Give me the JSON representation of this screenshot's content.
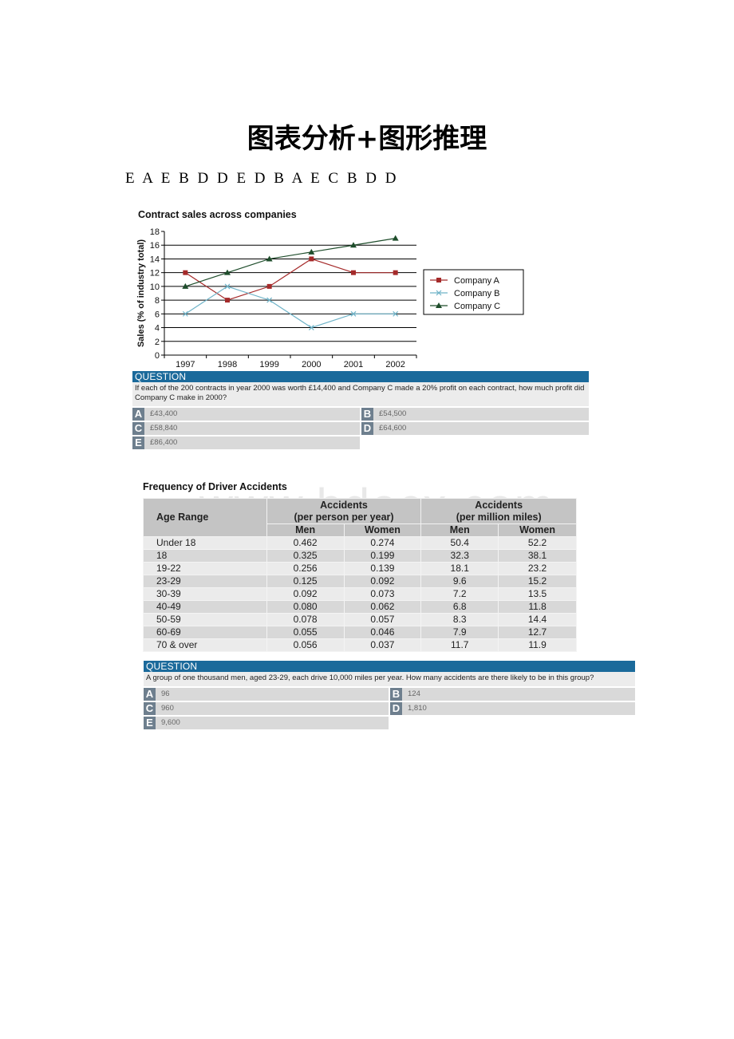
{
  "document": {
    "title": "图表分析+图形推理",
    "answer_key": "E A E B D D E D B A E C B D D",
    "watermark": "www.bdocx.com"
  },
  "chart_data": {
    "type": "line",
    "title": "Contract sales across companies",
    "xlabel": "",
    "ylabel": "Sales (% of industry total)",
    "x": [
      "1997",
      "1998",
      "1999",
      "2000",
      "2001",
      "2002"
    ],
    "ylim": [
      0,
      18
    ],
    "yticks": [
      0,
      2,
      4,
      6,
      8,
      10,
      12,
      14,
      16,
      18
    ],
    "grid": true,
    "legend_position": "right",
    "series": [
      {
        "name": "Company A",
        "values": [
          12,
          8,
          10,
          14,
          12,
          12
        ],
        "color": "#a52a2a",
        "marker": "square"
      },
      {
        "name": "Company B",
        "values": [
          6,
          10,
          8,
          4,
          6,
          6
        ],
        "color": "#6fb3c8",
        "marker": "x"
      },
      {
        "name": "Company C",
        "values": [
          10,
          12,
          14,
          15,
          16,
          17
        ],
        "color": "#1e4d2b",
        "marker": "triangle"
      }
    ]
  },
  "question1": {
    "header": "QUESTION",
    "text": "If each of the 200 contracts in year 2000 was worth £14,400 and Company C made a 20% profit on each contract, how much profit did Company C make in 2000?",
    "options": [
      {
        "letter": "A",
        "text": "£43,400"
      },
      {
        "letter": "B",
        "text": "£54,500"
      },
      {
        "letter": "C",
        "text": "£58,840"
      },
      {
        "letter": "D",
        "text": "£64,600"
      },
      {
        "letter": "E",
        "text": "£86,400"
      }
    ]
  },
  "table": {
    "title": "Frequency of Driver Accidents",
    "header": {
      "age_range": "Age Range",
      "group1": "Accidents",
      "group1_sub": "(per person per year)",
      "group2": "Accidents",
      "group2_sub": "(per million miles)",
      "men": "Men",
      "women": "Women"
    },
    "rows": [
      {
        "age": "Under 18",
        "pp_men": "0.462",
        "pp_women": "0.274",
        "pm_men": "50.4",
        "pm_women": "52.2"
      },
      {
        "age": "18",
        "pp_men": "0.325",
        "pp_women": "0.199",
        "pm_men": "32.3",
        "pm_women": "38.1"
      },
      {
        "age": "19-22",
        "pp_men": "0.256",
        "pp_women": "0.139",
        "pm_men": "18.1",
        "pm_women": "23.2"
      },
      {
        "age": "23-29",
        "pp_men": "0.125",
        "pp_women": "0.092",
        "pm_men": "9.6",
        "pm_women": "15.2"
      },
      {
        "age": "30-39",
        "pp_men": "0.092",
        "pp_women": "0.073",
        "pm_men": "7.2",
        "pm_women": "13.5"
      },
      {
        "age": "40-49",
        "pp_men": "0.080",
        "pp_women": "0.062",
        "pm_men": "6.8",
        "pm_women": "11.8"
      },
      {
        "age": "50-59",
        "pp_men": "0.078",
        "pp_women": "0.057",
        "pm_men": "8.3",
        "pm_women": "14.4"
      },
      {
        "age": "60-69",
        "pp_men": "0.055",
        "pp_women": "0.046",
        "pm_men": "7.9",
        "pm_women": "12.7"
      },
      {
        "age": "70 & over",
        "pp_men": "0.056",
        "pp_women": "0.037",
        "pm_men": "11.7",
        "pm_women": "11.9"
      }
    ]
  },
  "question2": {
    "header": "QUESTION",
    "text": "A group of one thousand men, aged 23-29, each drive 10,000 miles per year. How many accidents are there likely to be in this group?",
    "options": [
      {
        "letter": "A",
        "text": "96"
      },
      {
        "letter": "B",
        "text": "124"
      },
      {
        "letter": "C",
        "text": "960"
      },
      {
        "letter": "D",
        "text": "1,810"
      },
      {
        "letter": "E",
        "text": "9,600"
      }
    ]
  },
  "colors": {
    "question_header": "#1b6a9b",
    "option_letter_bg": "#6e7f8e",
    "option_bg": "#d9d9d9",
    "table_header_bg": "#c4c4c4"
  }
}
